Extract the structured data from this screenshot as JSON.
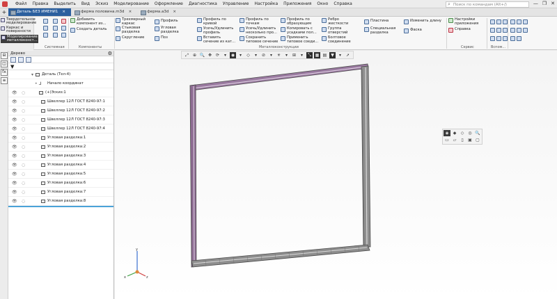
{
  "menu": [
    "Файл",
    "Правка",
    "Выделить",
    "Вид",
    "Эскиз",
    "Моделирование",
    "Оформление",
    "Диагностика",
    "Управление",
    "Настройка",
    "Приложения",
    "Окно",
    "Справка"
  ],
  "search_placeholder": "Поиск по командам (Alt+/)",
  "window_controls": [
    "—",
    "❐",
    "✕"
  ],
  "tabs": [
    {
      "label": "Деталь БЕЗ ИМЕНИ1",
      "close": "×",
      "active": true
    },
    {
      "label": "ферма половина.m3d",
      "close": "×",
      "active": false
    },
    {
      "label": "ферма.a3d",
      "close": "×",
      "active": false
    }
  ],
  "add_tab": "+",
  "left_tools": [
    {
      "label": "Твердотельное моделирование"
    },
    {
      "label": "Каркас и поверхности"
    },
    {
      "label": "Моделирование металлоконст..."
    }
  ],
  "ribbon": {
    "system_label": "Системная",
    "components_label": "Компоненты",
    "metal_label": "Металлоконструкции",
    "service_label": "Сервис",
    "other_label": "Вспом...",
    "add_component": "Добавить компонент из...",
    "create_part": "Создать деталь",
    "frame": "Трехмерный каркас",
    "joint_section": "Стыковая разделка",
    "fillet": "Скругление",
    "profile": "Профиль",
    "corner_section": "Угловая разделка",
    "pos": "Поз",
    "profile_curve": "Профиль по кривой",
    "trim_extend": "Усечь/Удлинить профиль",
    "insert_section": "Вставить сечение из кат...",
    "profile_points": "Профиль по точкам",
    "trim_multi": "Усечь/Удлинить несколько про...",
    "save_std": "Сохранить типовое сечение",
    "profile_gen": "Профиль по образующим",
    "copy_with": "Копировать с усадками пол...",
    "apply_std": "Применить типовое соеди...",
    "rib": "Ребро жесткости",
    "hole_group": "Группа отверстий",
    "bolt": "Болтовое соединение",
    "plate": "Пластина",
    "special_section": "Специальная разделка",
    "change_length": "Изменить длину",
    "chamfer": "Фаска",
    "app_settings": "Настройки приложения",
    "help": "Справка"
  },
  "panel": {
    "title": "Дерево",
    "gear": "⚙",
    "filter_icon": "▼",
    "fx_icon": "fx",
    "root": "Деталь (Тел-4)",
    "origin": "Начало координат",
    "sketch": "(+)Эскиз:1",
    "items": [
      {
        "label": "Швеллер 12Л ГОСТ 8240-97:1"
      },
      {
        "label": "Швеллер 12Л ГОСТ 8240-97:2"
      },
      {
        "label": "Швеллер 12Л ГОСТ 8240-97:3"
      },
      {
        "label": "Швеллер 12Л ГОСТ 8240-97:4"
      },
      {
        "label": "Угловая разделка:1"
      },
      {
        "label": "Угловая разделка:2"
      },
      {
        "label": "Угловая разделка:3"
      },
      {
        "label": "Угловая разделка:4"
      },
      {
        "label": "Угловая разделка:5"
      },
      {
        "label": "Угловая разделка:6"
      },
      {
        "label": "Угловая разделка:7"
      },
      {
        "label": "Угловая разделка:8"
      }
    ]
  },
  "triad": {
    "x": "x",
    "y": "y",
    "z": "z"
  },
  "colors": {
    "accent": "#2b5f9e",
    "frame": "#8a6a8e",
    "frame_dark": "#5e5e5e"
  }
}
